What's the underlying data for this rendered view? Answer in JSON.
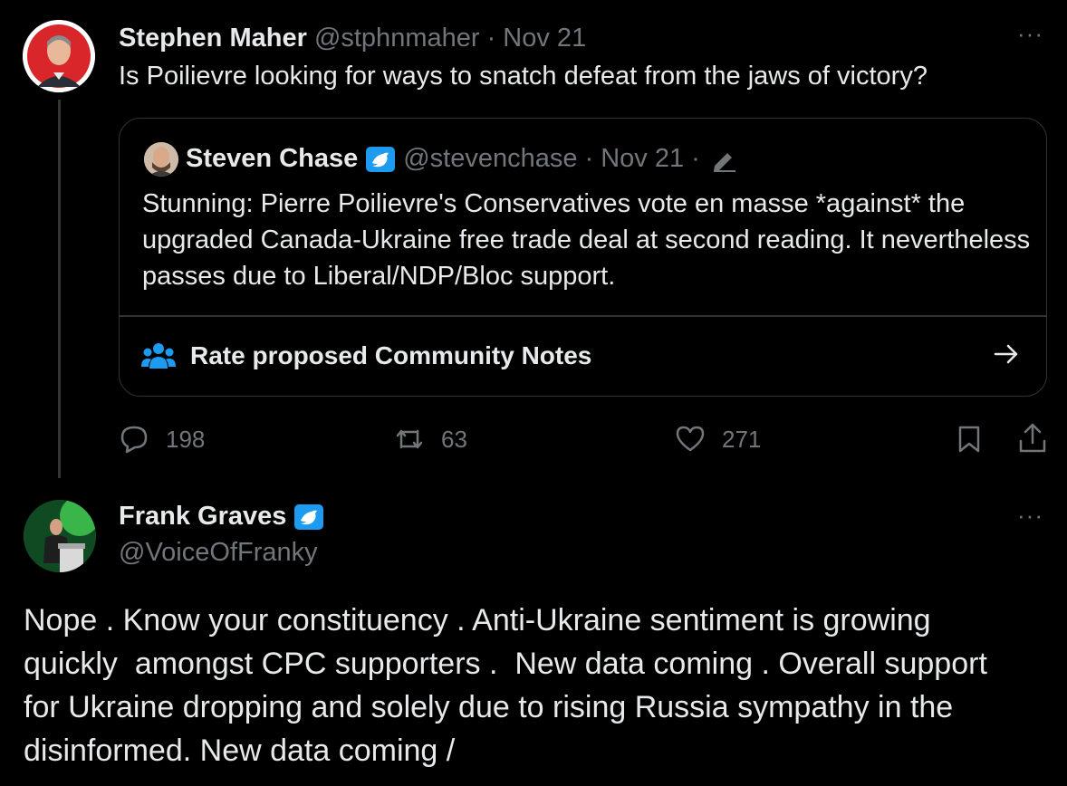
{
  "parent_tweet": {
    "author_name": "Stephen Maher",
    "handle": "@stphnmaher",
    "date": "· Nov 21",
    "text": "Is Poilievre looking for ways to snatch defeat from the jaws of victory?",
    "more_label": "···",
    "quote": {
      "author_name": "Steven Chase",
      "handle": "@stevenchase",
      "date": "· Nov 21 ·",
      "text": "Stunning: Pierre Poilievre's Conservatives vote en masse *against* the upgraded Canada-Ukraine free trade deal at second reading. It nevertheless passes due to Liberal/NDP/Bloc support.",
      "community_notes_label": "Rate proposed Community Notes"
    },
    "actions": {
      "replies": "198",
      "reposts": "63",
      "likes": "271"
    }
  },
  "main_tweet": {
    "author_name": "Frank Graves",
    "handle": "@VoiceOfFranky",
    "more_label": "···",
    "text": "Nope . Know your constituency . Anti-Ukraine sentiment is growing\nquickly  amongst CPC supporters .  New data coming . Overall support\nfor Ukraine dropping and solely due to rising Russia sympathy in the\ndisinformed. New data coming /"
  },
  "colors": {
    "background": "#000000",
    "text": "#e7e9ea",
    "muted": "#71767b",
    "border": "#2f3336",
    "verified_blue": "#1d9bf0"
  }
}
